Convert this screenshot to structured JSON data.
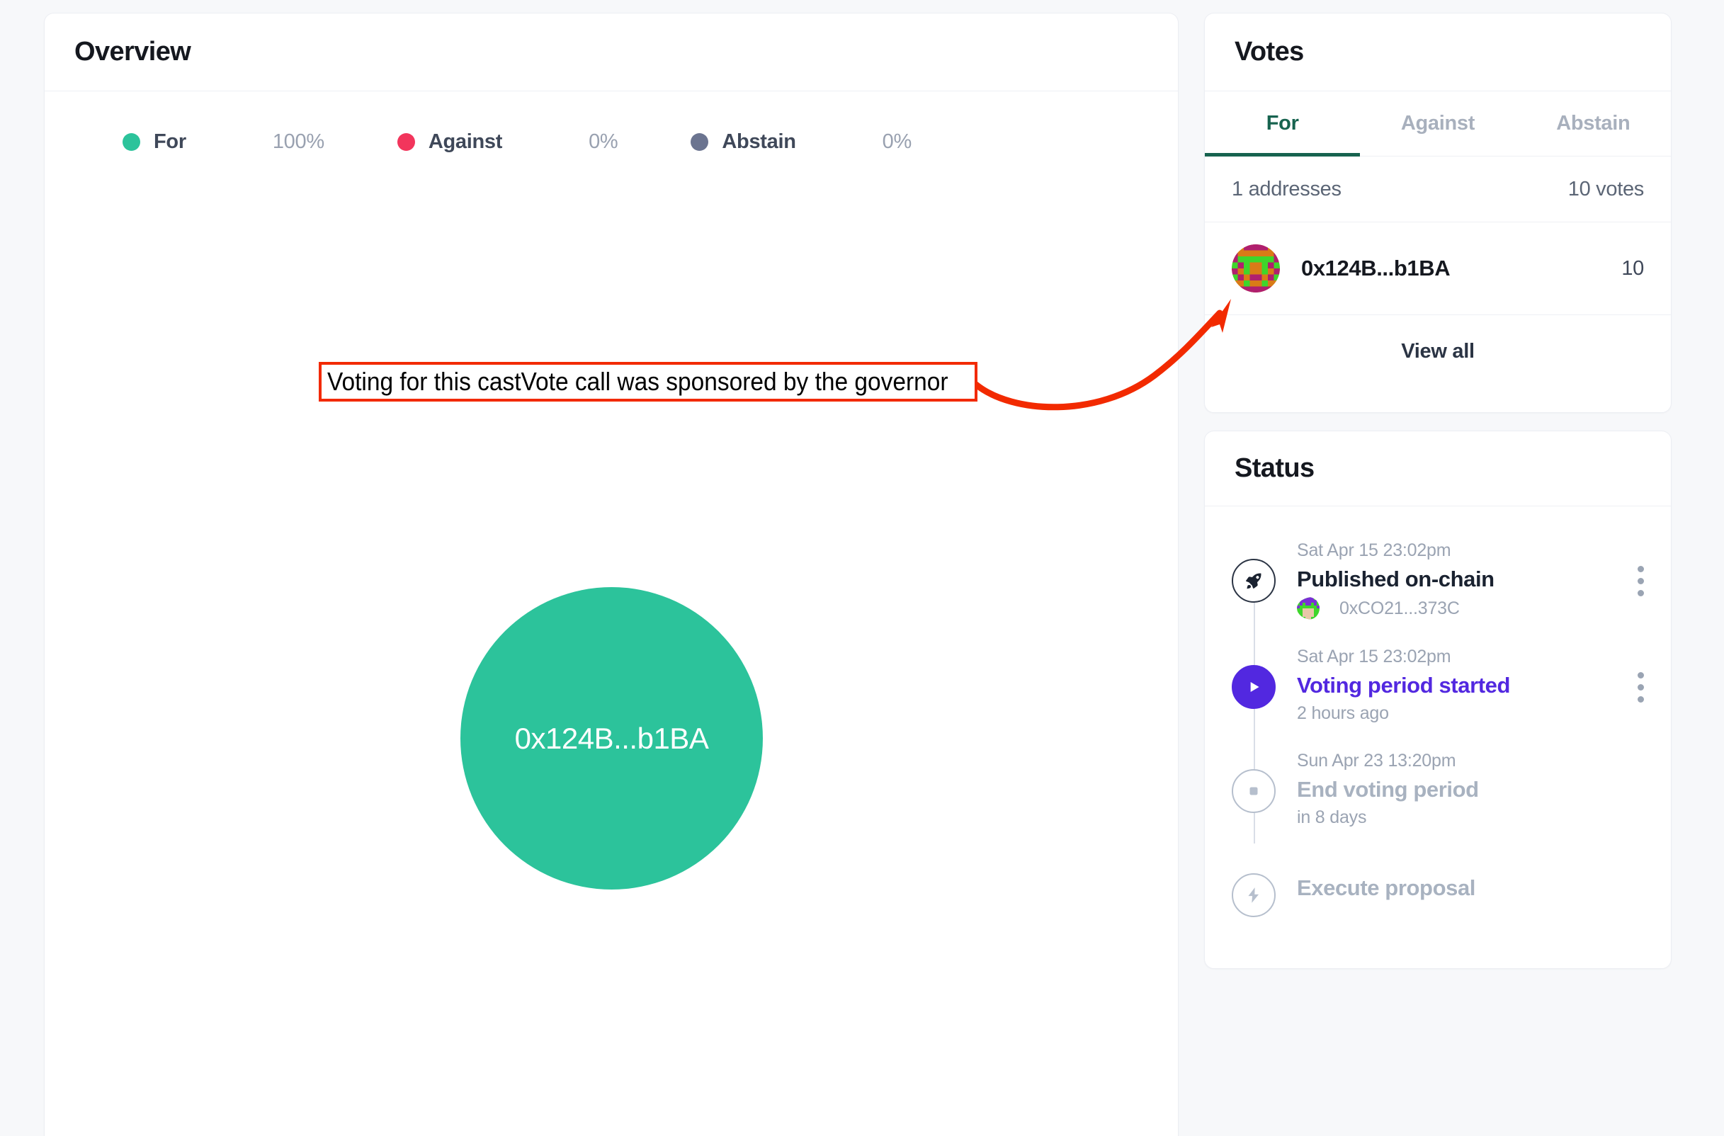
{
  "colors": {
    "page_background": "#f7f8fa",
    "card_background": "#ffffff",
    "for": "#2cc39b",
    "against": "#f2355c",
    "abstain": "#6b7490",
    "tab_active": "#17634f",
    "accent_purple": "#5228e0",
    "annotation_red": "#f22a00",
    "muted_text": "#9aa3b2"
  },
  "overview": {
    "title": "Overview",
    "legend": [
      {
        "label": "For",
        "percent": "100%",
        "color": "#2cc39b",
        "icon": "dot-icon"
      },
      {
        "label": "Against",
        "percent": "0%",
        "color": "#f2355c",
        "icon": "dot-icon"
      },
      {
        "label": "Abstain",
        "percent": "0%",
        "color": "#6b7490",
        "icon": "dot-icon"
      }
    ],
    "bubble": {
      "label": "0x124B...b1BA",
      "color": "#2cc39b"
    }
  },
  "chart_data": {
    "type": "pie",
    "title": "Overview",
    "categories": [
      "For",
      "Against",
      "Abstain"
    ],
    "values": [
      100,
      0,
      0
    ],
    "value_labels": [
      "100%",
      "0%",
      "0%"
    ],
    "colors": [
      "#2cc39b",
      "#f2355c",
      "#6b7490"
    ],
    "legend_position": "top-left",
    "bubbles": [
      {
        "label": "0x124B...b1BA",
        "votes": 10,
        "share": 100,
        "color": "#2cc39b"
      }
    ]
  },
  "votes": {
    "title": "Votes",
    "tabs": [
      {
        "label": "For",
        "active": true
      },
      {
        "label": "Against",
        "active": false
      },
      {
        "label": "Abstain",
        "active": false
      }
    ],
    "summary": {
      "addresses": "1 addresses",
      "votes": "10 votes"
    },
    "voters": [
      {
        "address": "0x124B...b1BA",
        "weight": "10",
        "avatar": "identicon-avatar"
      }
    ],
    "view_all": "View all"
  },
  "status": {
    "title": "Status",
    "timeline": [
      {
        "time": "Sat Apr 15 23:02pm",
        "title": "Published on-chain",
        "sub": "0xCO21...373C",
        "sub_has_avatar": true,
        "icon": "rocket-icon",
        "state": "done",
        "has_menu": true
      },
      {
        "time": "Sat Apr 15 23:02pm",
        "title": "Voting period started",
        "sub": "2 hours ago",
        "sub_has_avatar": false,
        "icon": "play-icon",
        "state": "active",
        "has_menu": true
      },
      {
        "time": "Sun Apr 23 13:20pm",
        "title": "End voting period",
        "sub": "in 8 days",
        "sub_has_avatar": false,
        "icon": "stop-icon",
        "state": "pending",
        "has_menu": false
      },
      {
        "time": "",
        "title": "Execute proposal",
        "sub": "",
        "sub_has_avatar": false,
        "icon": "bolt-icon",
        "state": "pending",
        "has_menu": false
      }
    ]
  },
  "annotation": {
    "text": "Voting for this castVote call was sponsored by the governor",
    "arrow": "curved-arrow-icon",
    "color": "#f22a00"
  }
}
